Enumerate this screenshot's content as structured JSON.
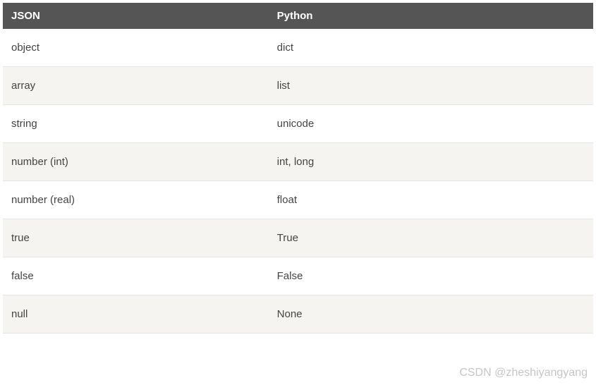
{
  "table": {
    "headers": [
      "JSON",
      "Python"
    ],
    "rows": [
      {
        "json": "object",
        "python": "dict"
      },
      {
        "json": "array",
        "python": "list"
      },
      {
        "json": "string",
        "python": "unicode"
      },
      {
        "json": "number (int)",
        "python": "int, long"
      },
      {
        "json": "number (real)",
        "python": "float"
      },
      {
        "json": "true",
        "python": "True"
      },
      {
        "json": "false",
        "python": "False"
      },
      {
        "json": "null",
        "python": "None"
      }
    ]
  },
  "watermark": "CSDN @zheshiyangyang"
}
